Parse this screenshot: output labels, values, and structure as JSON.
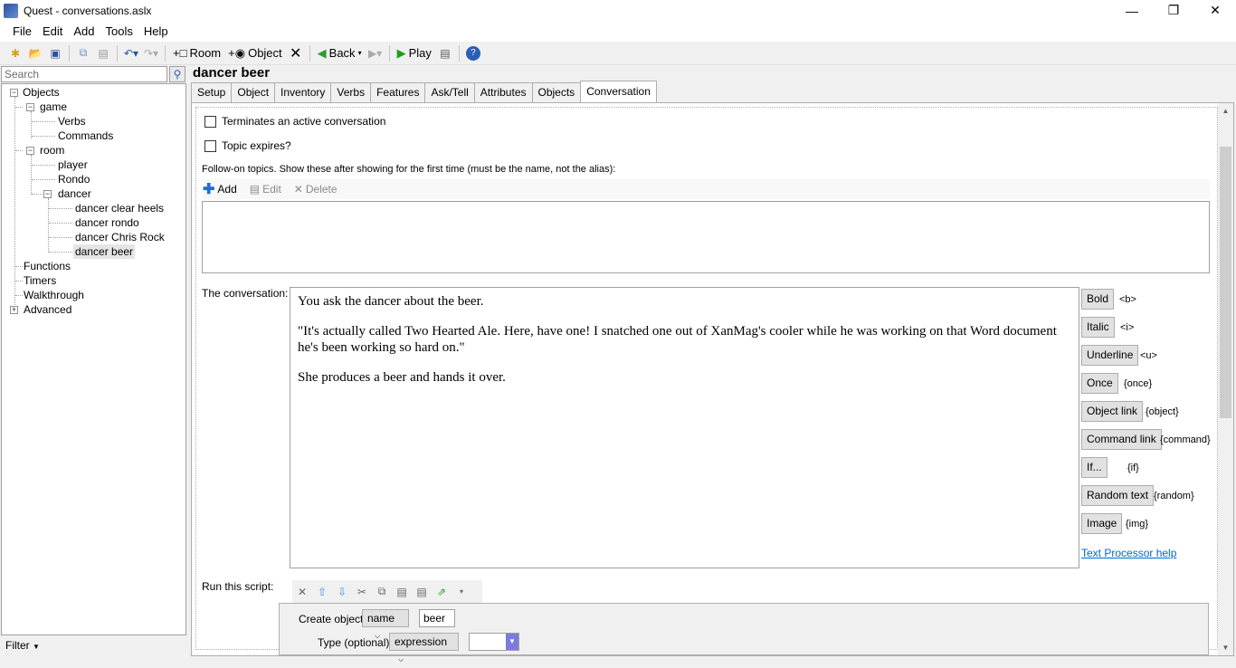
{
  "window": {
    "title": "Quest - conversations.aslx"
  },
  "menu": [
    "File",
    "Edit",
    "Add",
    "Tools",
    "Help"
  ],
  "toolbar": {
    "room": "Room",
    "object": "Object",
    "back": "Back",
    "play": "Play"
  },
  "search": {
    "placeholder": "Search"
  },
  "tree": {
    "objects": "Objects",
    "game": "game",
    "verbs": "Verbs",
    "commands": "Commands",
    "room": "room",
    "player": "player",
    "rondo": "Rondo",
    "dancer": "dancer",
    "dancer_clear_heels": "dancer clear heels",
    "dancer_rondo": "dancer rondo",
    "dancer_chris_rock": "dancer Chris Rock",
    "dancer_beer": "dancer beer",
    "functions": "Functions",
    "timers": "Timers",
    "walkthrough": "Walkthrough",
    "advanced": "Advanced"
  },
  "filter": "Filter",
  "object_title": "dancer beer",
  "tabs": [
    "Setup",
    "Object",
    "Inventory",
    "Verbs",
    "Features",
    "Ask/Tell",
    "Attributes",
    "Objects",
    "Conversation"
  ],
  "conversation": {
    "terminates": "Terminates an active conversation",
    "topic_expires": "Topic expires?",
    "follow_on": "Follow-on topics. Show these after showing for the first time (must be the name, not the alias):",
    "add": "Add",
    "edit": "Edit",
    "delete": "Delete",
    "conv_label": "The conversation:",
    "text": [
      "You ask the dancer about the beer.",
      "\"It's actually called Two Hearted Ale.  Here, have one!  I snatched one out of XanMag's cooler while he was working on that Word document he's been working so hard on.\"",
      "She produces a beer and hands it over."
    ],
    "run_script": "Run this script:"
  },
  "format": {
    "bold": "Bold",
    "bold_code": "<b>",
    "italic": "Italic",
    "italic_code": "<i>",
    "underline": "Underline",
    "underline_code": "<u>",
    "once": "Once",
    "once_code": "{once}",
    "object_link": "Object link",
    "object_link_code": "{object}",
    "command_link": "Command link",
    "command_link_code": "{command}",
    "if": "If...",
    "if_code": "{if}",
    "random": "Random text",
    "random_code": "{random}",
    "image": "Image",
    "image_code": "{img}",
    "help": "Text Processor help"
  },
  "script": {
    "create_object": "Create object",
    "name_sel": "name",
    "name_val": "beer",
    "type_label": "Type (optional):",
    "type_sel": "expression"
  }
}
